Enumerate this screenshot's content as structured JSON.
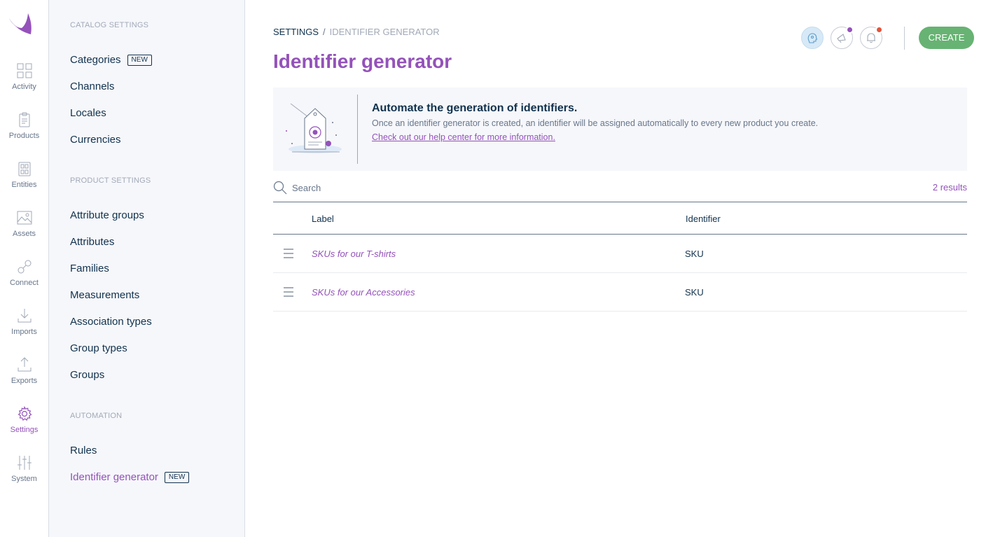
{
  "rail": {
    "items": [
      {
        "label": "Activity",
        "icon": "activity-icon"
      },
      {
        "label": "Products",
        "icon": "products-icon"
      },
      {
        "label": "Entities",
        "icon": "entities-icon"
      },
      {
        "label": "Assets",
        "icon": "assets-icon"
      },
      {
        "label": "Connect",
        "icon": "connect-icon"
      },
      {
        "label": "Imports",
        "icon": "imports-icon"
      },
      {
        "label": "Exports",
        "icon": "exports-icon"
      },
      {
        "label": "Settings",
        "icon": "gear-icon",
        "active": true
      },
      {
        "label": "System",
        "icon": "sliders-icon"
      }
    ]
  },
  "sidebar": {
    "sections": [
      {
        "title": "CATALOG SETTINGS",
        "items": [
          {
            "label": "Categories",
            "badge": "NEW"
          },
          {
            "label": "Channels"
          },
          {
            "label": "Locales"
          },
          {
            "label": "Currencies"
          }
        ]
      },
      {
        "title": "PRODUCT SETTINGS",
        "items": [
          {
            "label": "Attribute groups"
          },
          {
            "label": "Attributes"
          },
          {
            "label": "Families"
          },
          {
            "label": "Measurements"
          },
          {
            "label": "Association types"
          },
          {
            "label": "Group types"
          },
          {
            "label": "Groups"
          }
        ]
      },
      {
        "title": "AUTOMATION",
        "items": [
          {
            "label": "Rules"
          },
          {
            "label": "Identifier generator",
            "badge": "NEW",
            "active": true
          }
        ]
      }
    ]
  },
  "header": {
    "breadcrumb": {
      "root": "SETTINGS",
      "separator": "/",
      "current": "IDENTIFIER GENERATOR"
    },
    "title": "Identifier generator",
    "create_label": "CREATE"
  },
  "helper": {
    "title": "Automate the generation of identifiers.",
    "text": "Once an identifier generator is created, an identifier will be assigned automatically to every new product you create.",
    "link": "Check out our help center for more information."
  },
  "search": {
    "placeholder": "Search",
    "value": "",
    "results": "2 results"
  },
  "table": {
    "columns": [
      "Label",
      "Identifier"
    ],
    "rows": [
      {
        "label": "SKUs for our T-shirts",
        "identifier": "SKU"
      },
      {
        "label": "SKUs for our Accessories",
        "identifier": "SKU"
      }
    ]
  },
  "colors": {
    "brand": "#9452ba",
    "primary_text": "#11324d",
    "muted_text": "#67768a",
    "create_button": "#67b373",
    "notification_dot": "#e0553d",
    "announcement_dot": "#9452ba"
  }
}
